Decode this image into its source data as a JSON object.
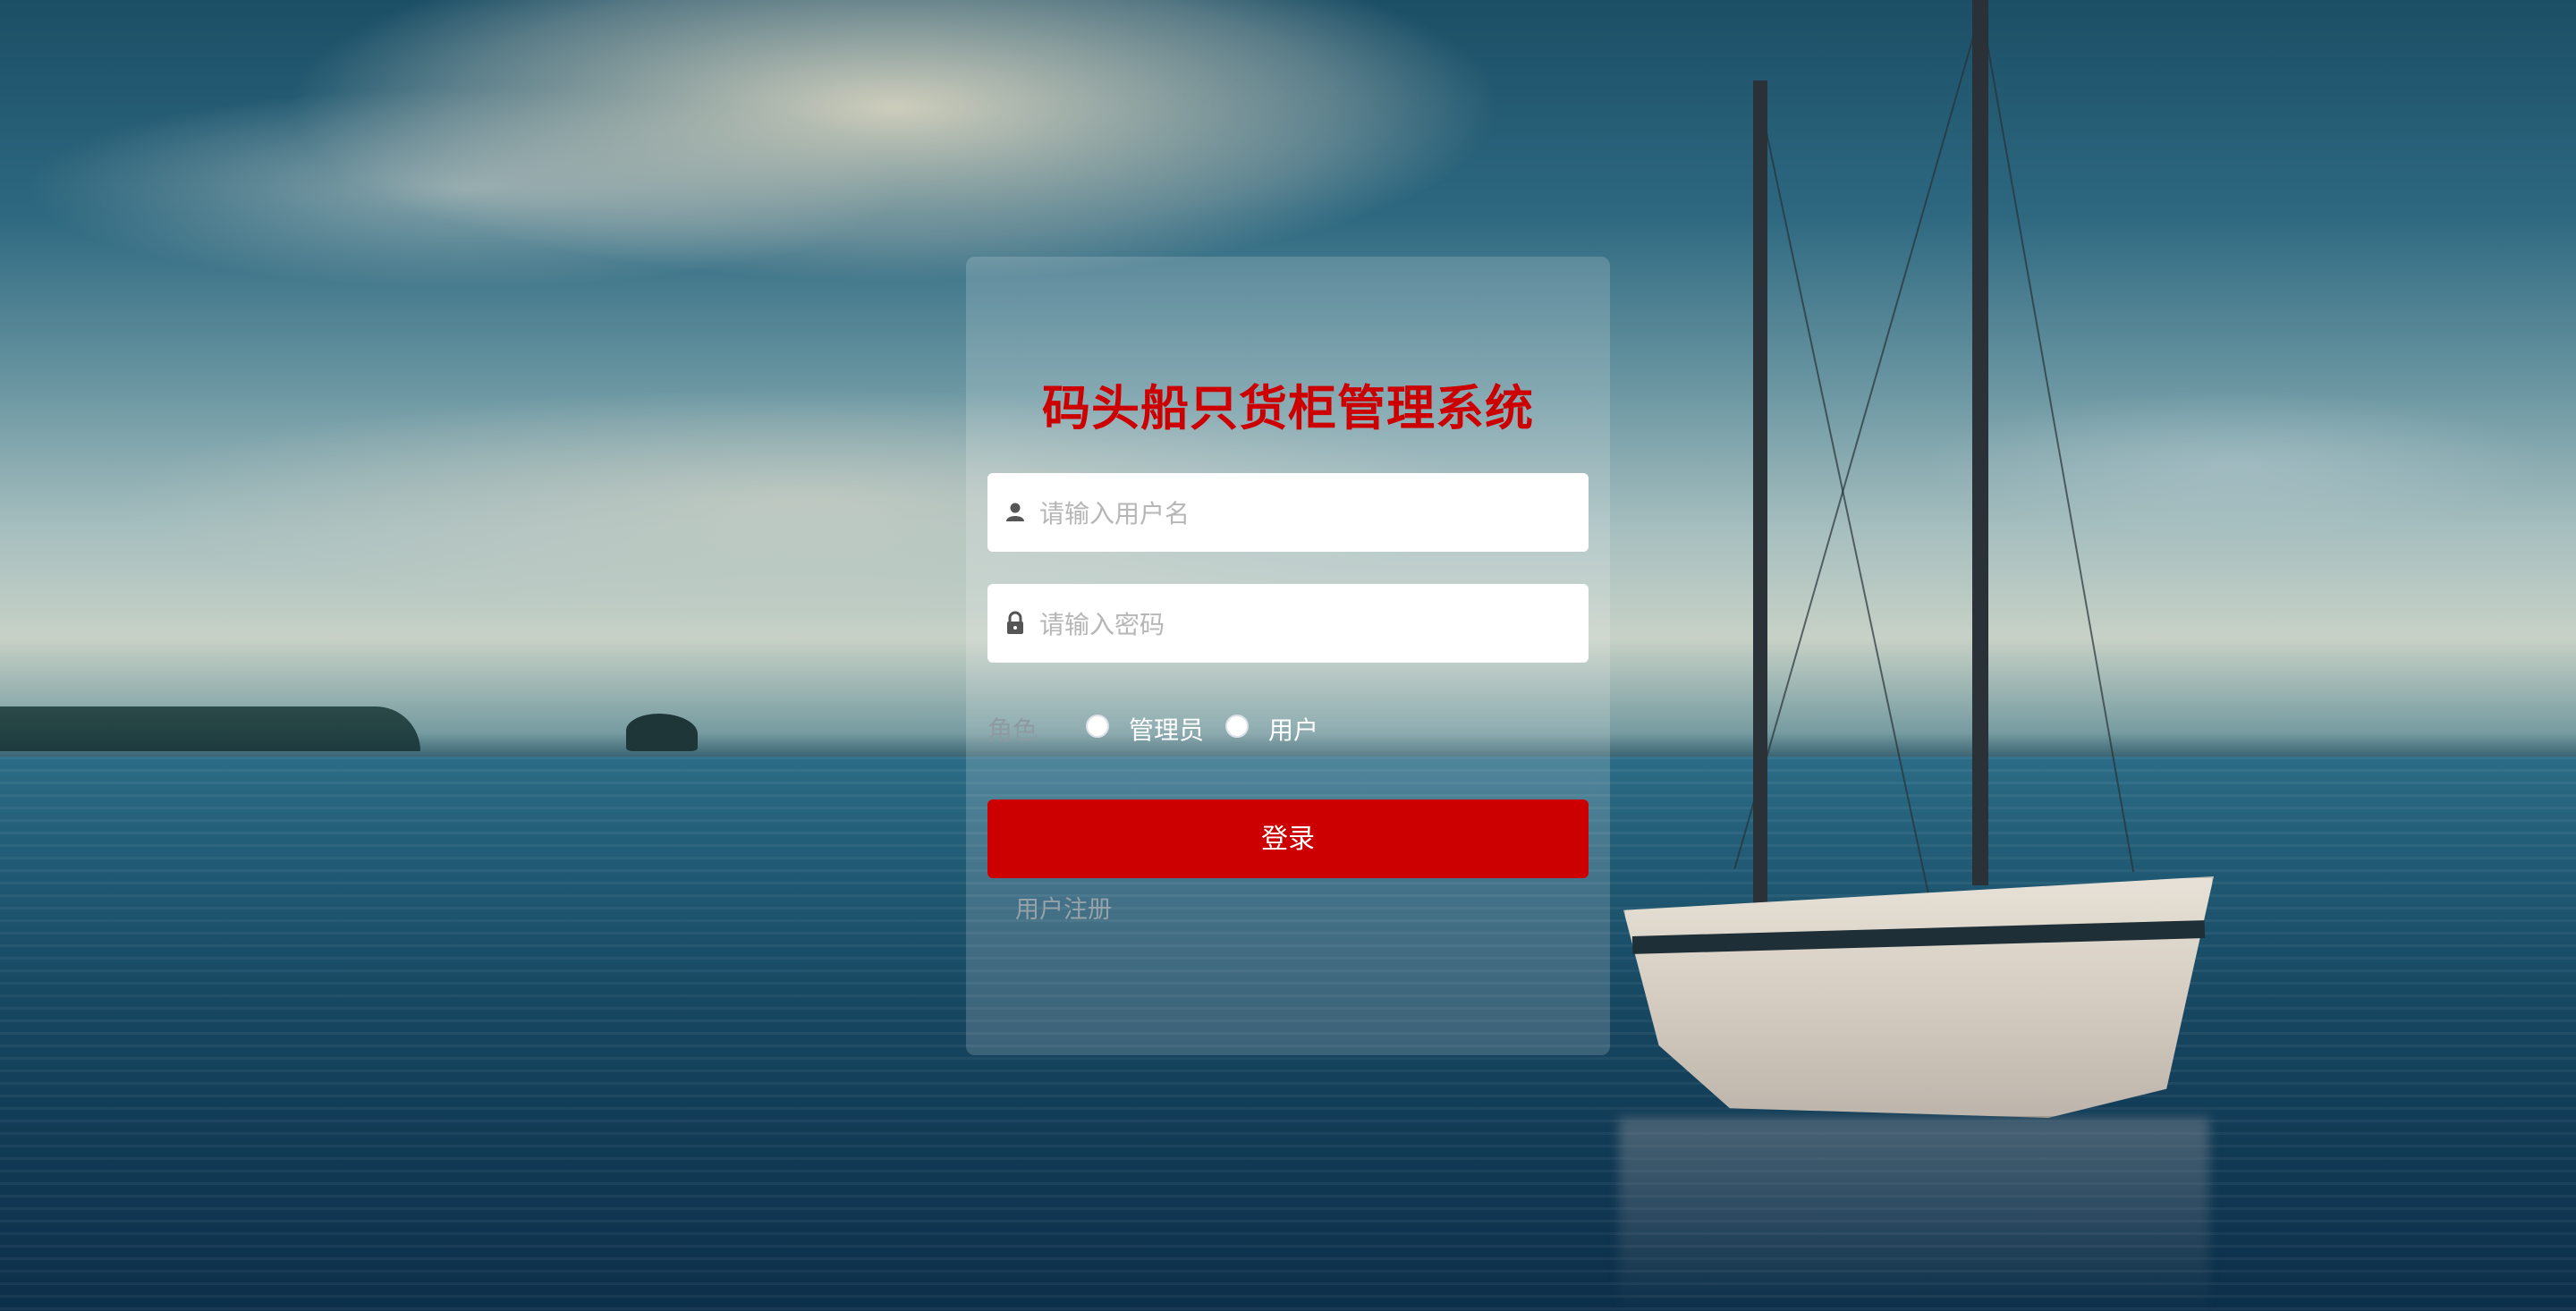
{
  "page": {
    "title": "码头船只货柜管理系统"
  },
  "login_form": {
    "username": {
      "placeholder": "请输入用户名",
      "value": "",
      "icon": "user-icon"
    },
    "password": {
      "placeholder": "请输入密码",
      "value": "",
      "icon": "lock-icon"
    },
    "role": {
      "label": "角色",
      "options": [
        "管理员",
        "用户"
      ],
      "selected": null
    },
    "login_button_label": "登录",
    "register_link_label": "用户注册"
  },
  "colors": {
    "accent": "#cc0000",
    "panel_bg": "rgba(255,255,255,0.17)",
    "input_bg": "#ffffff",
    "placeholder": "#b6b6b6",
    "muted_text": "#96a2a9"
  }
}
